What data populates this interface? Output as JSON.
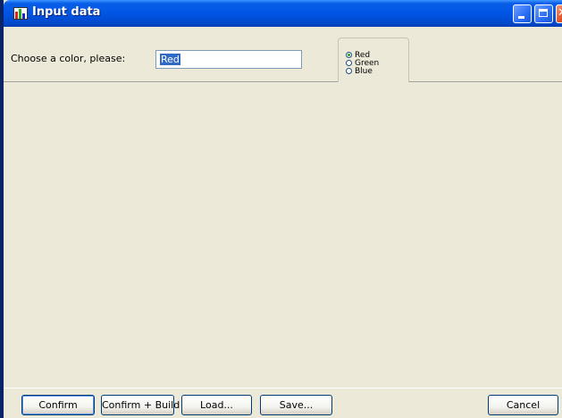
{
  "window": {
    "title": "Input data"
  },
  "form": {
    "prompt": "Choose a color, please:",
    "color_value": "Red",
    "radio_options": [
      {
        "label": "Red",
        "selected": true
      },
      {
        "label": "Green",
        "selected": false
      },
      {
        "label": "Blue",
        "selected": false
      }
    ]
  },
  "buttons": {
    "confirm": "Confirm",
    "confirm_build": "Confirm + Build",
    "load": "Load...",
    "save": "Save...",
    "cancel": "Cancel"
  },
  "colors": {
    "titlebar": "#0055e5",
    "background": "#ece9d8",
    "selection": "#316ac5"
  }
}
